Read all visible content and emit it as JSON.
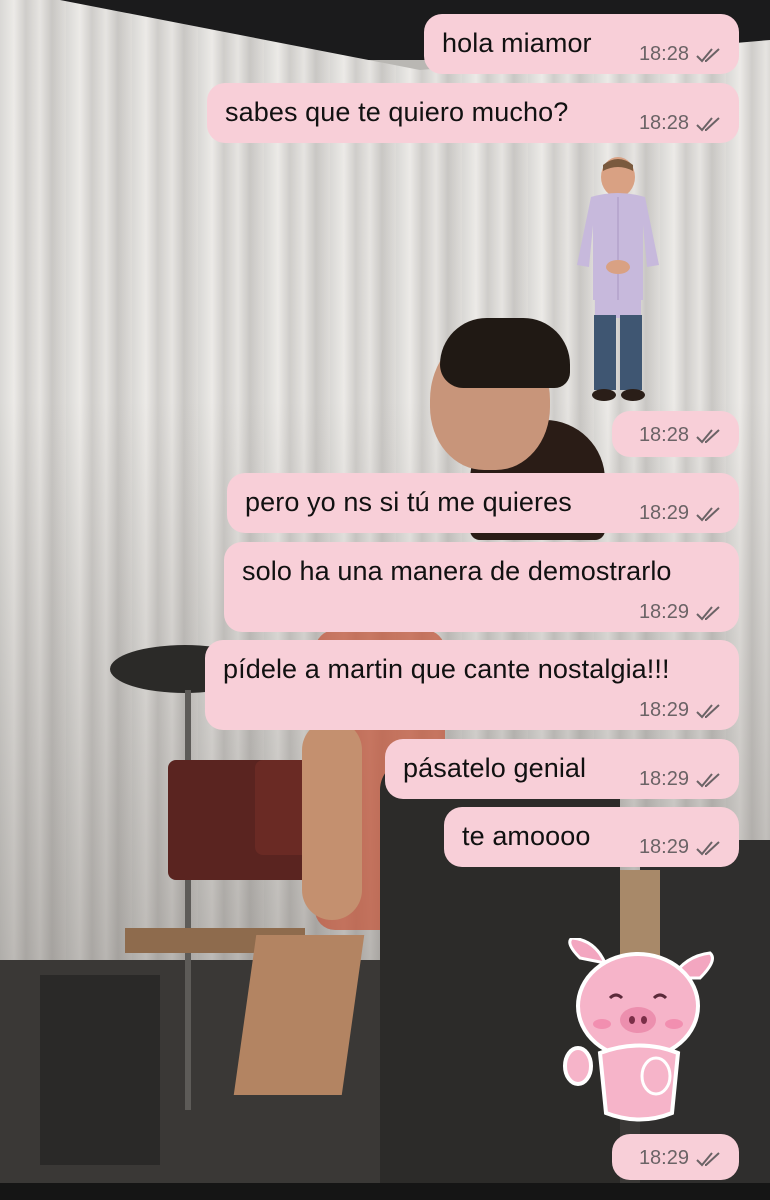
{
  "messages": [
    {
      "text": "hola miamor",
      "time": "18:28"
    },
    {
      "text": "sabes que te quiero mucho?",
      "time": "18:28"
    },
    {
      "sticker": "man-standing-sticker",
      "time": "18:28"
    },
    {
      "text": "pero yo ns si tú me quieres",
      "time": "18:29"
    },
    {
      "text": "solo ha una manera de demostrarlo",
      "time": "18:29"
    },
    {
      "text": "pídele a martin que cante nostalgia!!!",
      "time": "18:29"
    },
    {
      "text": "pásatelo genial",
      "time": "18:29"
    },
    {
      "text": "te amoooo",
      "time": "18:29"
    },
    {
      "sticker": "pig-waving-sticker",
      "time": "18:29"
    }
  ],
  "colors": {
    "bubble": "#f8cfd8",
    "text": "#111111",
    "meta": "#6b6366"
  },
  "icons": {
    "read_receipt": "double-check-icon"
  }
}
